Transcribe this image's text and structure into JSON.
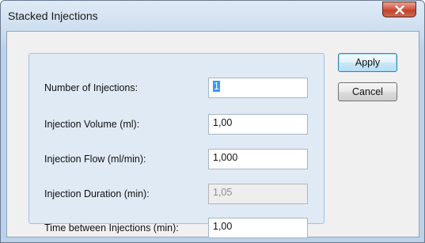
{
  "window": {
    "title": "Stacked Injections",
    "close_icon": "close-x-icon"
  },
  "form": {
    "fields": [
      {
        "label": "Number of Injections:",
        "value": "1",
        "enabled": true,
        "selected": true
      },
      {
        "label": "Injection Volume (ml):",
        "value": "1,00",
        "enabled": true
      },
      {
        "label": "Injection Flow (ml/min):",
        "value": "1,000",
        "enabled": true
      },
      {
        "label": "Injection Duration (min):",
        "value": "1,05",
        "enabled": false
      },
      {
        "label": "Time between Injections (min):",
        "value": "1,00",
        "enabled": true
      }
    ]
  },
  "buttons": {
    "apply_label": "Apply",
    "cancel_label": "Cancel"
  },
  "colors": {
    "selection": "#3399ff",
    "close_button": "#c1422c",
    "group_background": "#dfeaf5"
  }
}
